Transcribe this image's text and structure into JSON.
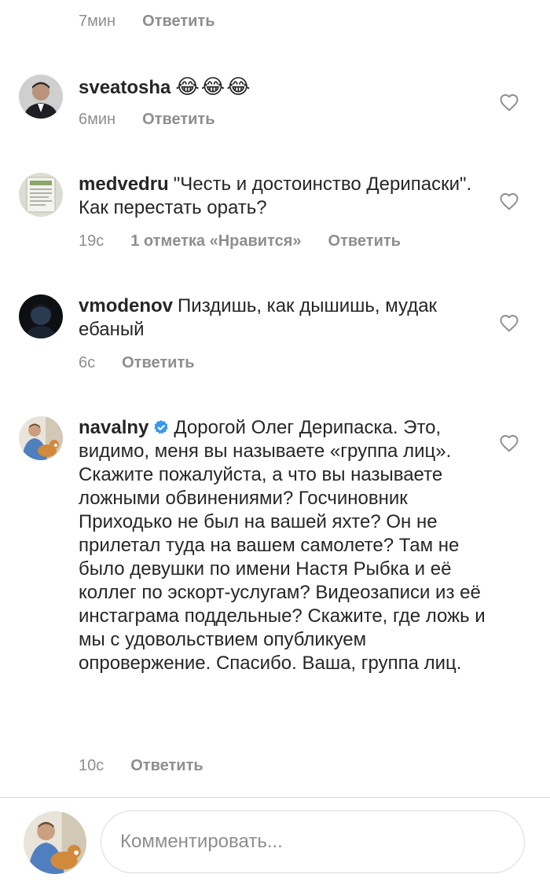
{
  "top": {
    "time": "7мин",
    "reply": "Ответить"
  },
  "comments": [
    {
      "username": "sveatosha",
      "text": "",
      "emoji": "😂😂😂",
      "time": "6мин",
      "likes": "",
      "reply": "Ответить",
      "avatar_icon": "avatar-man-suit"
    },
    {
      "username": "medvedru",
      "text": "\"Честь и достоинство Дерипаски\". Как перестать орать?",
      "time": "19с",
      "likes": "1 отметка «Нравится»",
      "reply": "Ответить",
      "avatar_icon": "avatar-document"
    },
    {
      "username": "vmodenov",
      "text": "Пиздишь, как дышишь, мудак ебаный",
      "time": "6с",
      "likes": "",
      "reply": "Ответить",
      "avatar_icon": "avatar-dark-portrait"
    },
    {
      "username": "navalny",
      "verified": true,
      "text": "Дорогой Олег Дерипаска. Это, видимо, меня вы называете «группа лиц». Скажите пожалуйста, а что вы называете ложными обвинениями? Госчиновник Приходько не был на вашей яхте? Он не прилетал туда на вашем самолете? Там не было девушки по имени Настя Рыбка и её коллег по эскорт-услугам? Видеозаписи из её инстаграма поддельные? Скажите, где ложь и мы с удовольствием опубликуем опровержение. Спасибо. Ваша, группа лиц.",
      "time": "10с",
      "likes": "",
      "reply": "Ответить",
      "avatar_icon": "avatar-man-with-dog"
    }
  ],
  "composer": {
    "placeholder": "Комментировать...",
    "avatar_icon": "avatar-man-with-dog"
  },
  "colors": {
    "text": "#262626",
    "secondary": "#8e8e8e",
    "border": "#dbdbdb",
    "verified": "#3897f0"
  }
}
